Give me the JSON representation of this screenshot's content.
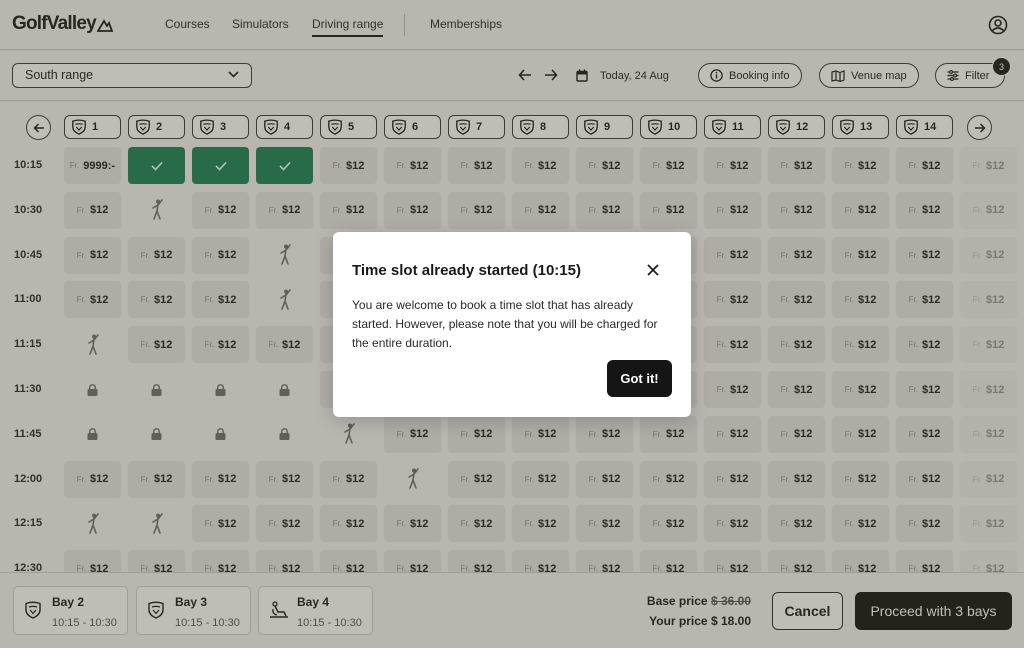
{
  "header": {
    "logo_text": "GolfValley",
    "nav": [
      {
        "label": "Courses",
        "active": false
      },
      {
        "label": "Simulators",
        "active": false
      },
      {
        "label": "Driving range",
        "active": true
      },
      {
        "label": "Memberships",
        "active": false
      }
    ]
  },
  "toolbar": {
    "range_select": "South range",
    "date": "Today, 24 Aug",
    "booking_info": "Booking info",
    "venue_map": "Venue map",
    "filter": "Filter",
    "filter_count": "3"
  },
  "grid": {
    "bays": [
      "1",
      "2",
      "3",
      "4",
      "5",
      "6",
      "7",
      "8",
      "9",
      "10",
      "11",
      "12",
      "13",
      "14"
    ],
    "times": [
      "10:15",
      "10:30",
      "10:45",
      "11:00",
      "11:15",
      "11:30",
      "11:45",
      "12:00",
      "12:15",
      "12:30"
    ],
    "price_prefix": "Fr.",
    "price": "$12",
    "special_price": "9999:-",
    "legend": "cell codes: S selected, G occupied (golfer), L locked, P price, X special price",
    "rows": [
      "XSSSPPPPPPPPPPP",
      "PGPPPPPPPPPPPPP",
      "PPPGPPPPPPPPPPP",
      "PPPGPPPPPPPPPPP",
      "GPPPPPPPPPPPPPP",
      "LLLLPPPPPPPPPPP",
      "LLLLGPPPPPPPPPP",
      "PPPPPGPPPPPPPPP",
      "GGPPPPPPPPPPPPP",
      "PPPPPPPPPPPPPPP"
    ]
  },
  "modal": {
    "title": "Time slot already started (10:15)",
    "body": "You are welcome to book a time slot that has already started. However, please note that you will be charged for the entire duration.",
    "button": "Got it!"
  },
  "footer": {
    "selections": [
      {
        "bay": "Bay 2",
        "time": "10:15 - 10:30",
        "icon": "golf-shield-icon"
      },
      {
        "bay": "Bay 3",
        "time": "10:15 - 10:30",
        "icon": "golf-shield-icon"
      },
      {
        "bay": "Bay 4",
        "time": "10:15 - 10:30",
        "icon": "accessible-bay-icon"
      }
    ],
    "base_price_label": "Base price",
    "base_price": "$ 36.00",
    "your_price_label": "Your price",
    "your_price": "$ 18.00",
    "cancel": "Cancel",
    "proceed": "Proceed with 3 bays"
  }
}
